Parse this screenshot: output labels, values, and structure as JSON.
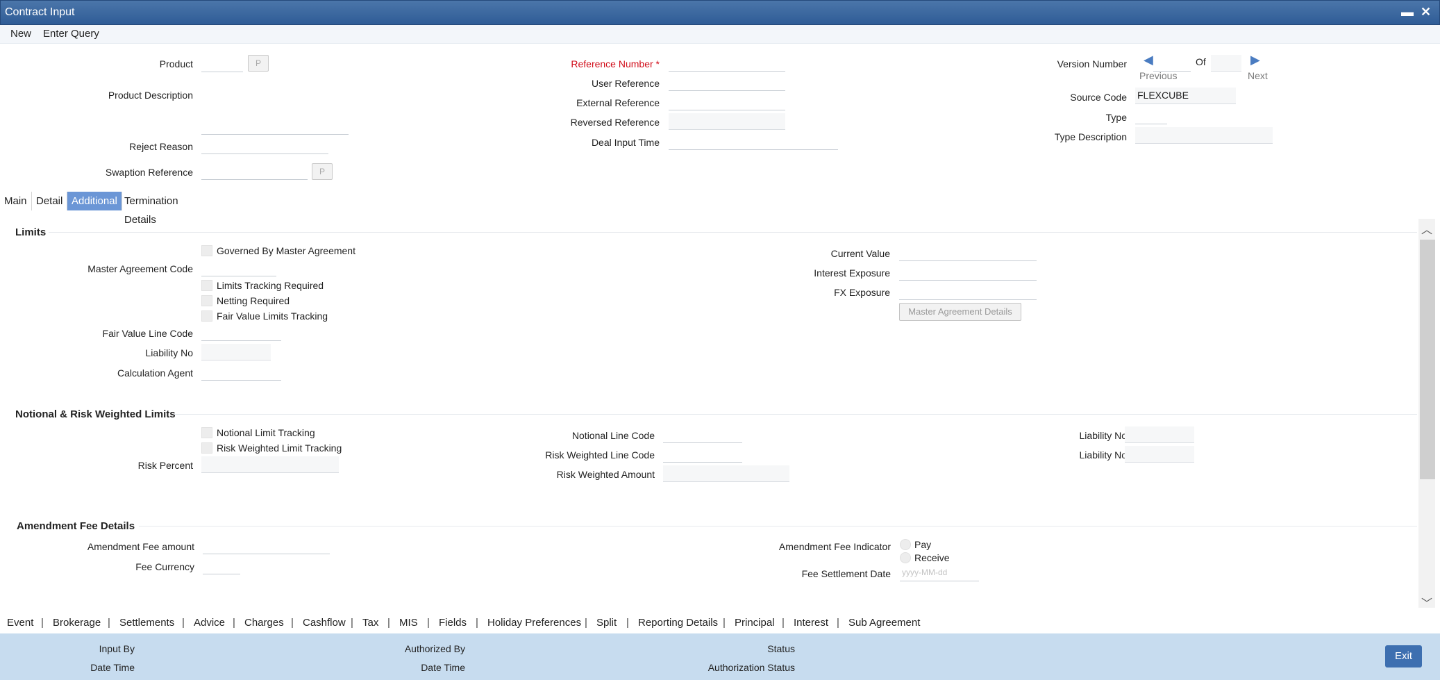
{
  "window": {
    "title": "Contract Input",
    "minimize_symbol": "▬",
    "close_symbol": "✕"
  },
  "menu": {
    "new": "New",
    "enter_query": "Enter Query"
  },
  "header": {
    "product_label": "Product",
    "product_button": "P",
    "product_description_label": "Product Description",
    "reject_reason_label": "Reject Reason",
    "swaption_reference_label": "Swaption Reference",
    "swaption_button": "P",
    "reference_number_label": "Reference Number",
    "required_star": "*",
    "user_reference_label": "User Reference",
    "external_reference_label": "External Reference",
    "reversed_reference_label": "Reversed Reference",
    "deal_input_time_label": "Deal Input Time",
    "version_number_label": "Version Number",
    "of_label": "Of",
    "previous_label": "Previous",
    "next_label": "Next",
    "source_code_label": "Source Code",
    "source_code_value": "FLEXCUBE",
    "type_label": "Type",
    "type_description_label": "Type Description"
  },
  "tabs": [
    "Main",
    "Detail",
    "Additional",
    "Termination Details"
  ],
  "limits": {
    "title": "Limits",
    "governed_by_master_agreement": "Governed By Master Agreement",
    "master_agreement_code_label": "Master Agreement Code",
    "limits_tracking_required": "Limits Tracking Required",
    "netting_required": "Netting Required",
    "fair_value_limits_tracking": "Fair Value Limits Tracking",
    "fair_value_line_code_label": "Fair Value Line Code",
    "liability_no_label": "Liability No",
    "calculation_agent_label": "Calculation Agent",
    "current_value_label": "Current Value",
    "interest_exposure_label": "Interest Exposure",
    "fx_exposure_label": "FX Exposure",
    "master_agreement_details_button": "Master Agreement Details"
  },
  "notional": {
    "title": "Notional & Risk Weighted Limits",
    "notional_limit_tracking": "Notional Limit Tracking",
    "risk_weighted_limit_tracking": "Risk Weighted Limit Tracking",
    "risk_percent_label": "Risk Percent",
    "notional_line_code_label": "Notional Line Code",
    "risk_weighted_line_code_label": "Risk Weighted Line Code",
    "risk_weighted_amount_label": "Risk Weighted Amount",
    "liability_no_label_1": "Liability No",
    "liability_no_label_2": "Liability No"
  },
  "amendment": {
    "title": "Amendment Fee Details",
    "amendment_fee_amount_label": "Amendment Fee amount",
    "fee_currency_label": "Fee Currency",
    "amendment_fee_indicator_label": "Amendment Fee Indicator",
    "pay_label": "Pay",
    "receive_label": "Receive",
    "fee_settlement_date_label": "Fee Settlement Date",
    "date_placeholder": "yyyy-MM-dd"
  },
  "footer_links": [
    "Event",
    "Brokerage",
    "Settlements",
    "Advice",
    "Charges",
    "Cashflow",
    "Tax",
    "MIS",
    "Fields",
    "Holiday Preferences",
    "Split",
    "Reporting Details",
    "Principal",
    "Interest",
    "Sub Agreement"
  ],
  "footer_separator": "|",
  "status": {
    "input_by": "Input By",
    "date_time_1": "Date Time",
    "authorized_by": "Authorized By",
    "date_time_2": "Date Time",
    "status": "Status",
    "authorization_status": "Authorization Status",
    "exit": "Exit"
  },
  "icons": {
    "scroll_up": "︿",
    "scroll_down": "﹀",
    "previous_arrow": "◀",
    "next_arrow": "▶"
  },
  "colors": {
    "title_bar": "#3a649c",
    "active_tab": "#6b96d6",
    "status_bar": "#c7dcef",
    "required_label": "#d10d1a",
    "exit_button": "#3d6fb0"
  }
}
